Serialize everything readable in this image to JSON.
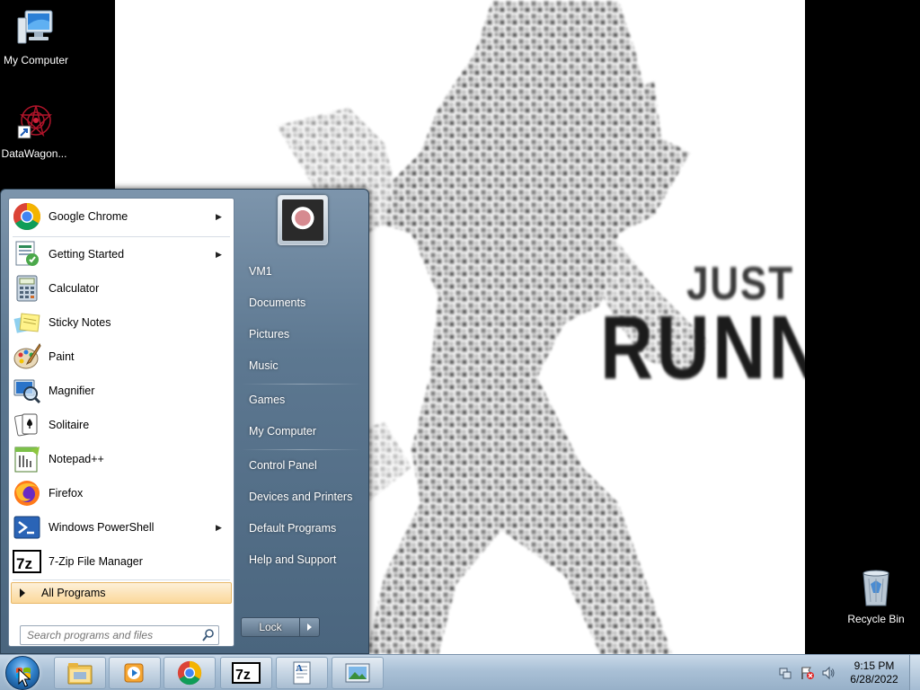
{
  "desktop": {
    "icons": [
      {
        "label": "My Computer",
        "icon": "my-computer-icon"
      },
      {
        "label": "DataWagon...",
        "icon": "datawagon-icon"
      },
      {
        "label": "Recycle Bin",
        "icon": "recycle-bin-icon"
      }
    ],
    "wallpaper": {
      "line1": "JUST K",
      "line2": "RUNNI"
    }
  },
  "start_menu": {
    "programs": [
      {
        "label": "Google Chrome",
        "icon": "chrome-icon",
        "submenu": true
      },
      {
        "label": "Getting Started",
        "icon": "getting-started-icon",
        "submenu": true
      },
      {
        "label": "Calculator",
        "icon": "calculator-icon",
        "submenu": false
      },
      {
        "label": "Sticky Notes",
        "icon": "sticky-notes-icon",
        "submenu": false
      },
      {
        "label": "Paint",
        "icon": "paint-icon",
        "submenu": false
      },
      {
        "label": "Magnifier",
        "icon": "magnifier-icon",
        "submenu": false
      },
      {
        "label": "Solitaire",
        "icon": "solitaire-icon",
        "submenu": false
      },
      {
        "label": "Notepad++",
        "icon": "notepadpp-icon",
        "submenu": false
      },
      {
        "label": "Firefox",
        "icon": "firefox-icon",
        "submenu": false
      },
      {
        "label": "Windows PowerShell",
        "icon": "powershell-icon",
        "submenu": true
      },
      {
        "label": "7-Zip File Manager",
        "icon": "7zip-icon",
        "submenu": false
      }
    ],
    "all_programs": "All Programs",
    "search_placeholder": "Search programs and files",
    "right_items": [
      {
        "label": "VM1"
      },
      {
        "label": "Documents"
      },
      {
        "label": "Pictures"
      },
      {
        "label": "Music"
      },
      {
        "label": "Games"
      },
      {
        "label": "My Computer"
      },
      {
        "label": "Control Panel"
      },
      {
        "label": "Devices and Printers"
      },
      {
        "label": "Default Programs"
      },
      {
        "label": "Help and Support"
      }
    ],
    "lock_label": "Lock"
  },
  "taskbar": {
    "pinned": [
      "file-explorer-icon",
      "media-player-icon",
      "chrome-icon",
      "7zip-icon",
      "wordpad-icon",
      "picture-viewer-icon"
    ],
    "tray_icons": [
      "network-icon",
      "action-center-flag-icon",
      "volume-icon"
    ],
    "time": "9:15 PM",
    "date": "6/28/2022"
  }
}
